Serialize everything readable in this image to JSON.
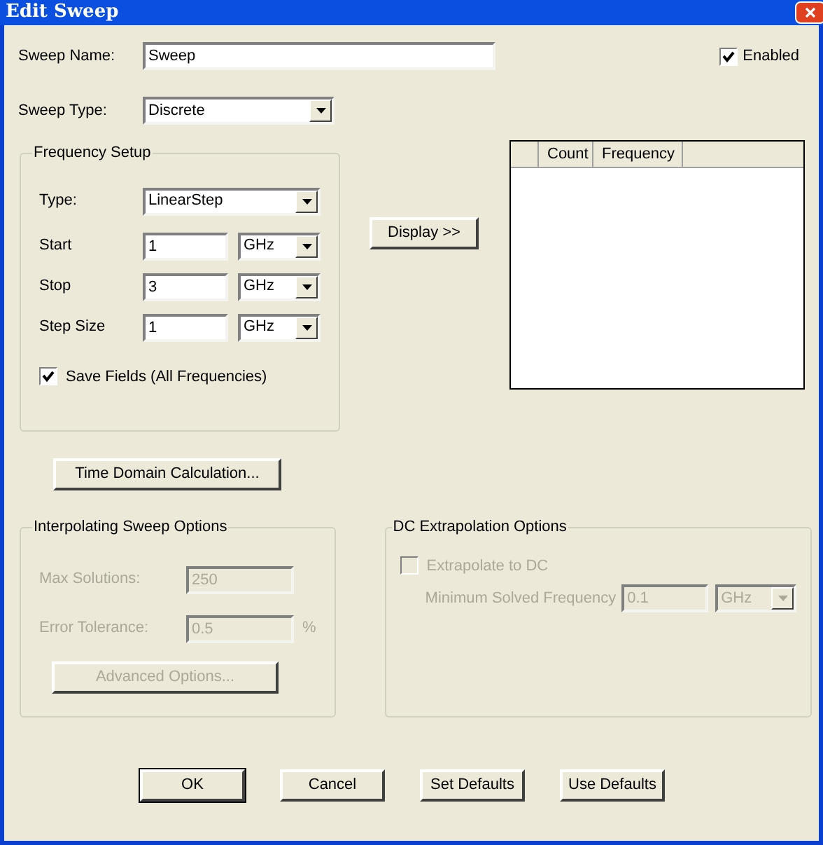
{
  "window": {
    "title": "Edit Sweep"
  },
  "sweep_name": {
    "label": "Sweep Name:",
    "value": "Sweep"
  },
  "enabled": {
    "label": "Enabled",
    "checked": true
  },
  "sweep_type": {
    "label": "Sweep Type:",
    "value": "Discrete"
  },
  "frequency_setup": {
    "title": "Frequency Setup",
    "type": {
      "label": "Type:",
      "value": "LinearStep"
    },
    "rows": [
      {
        "label": "Start",
        "value": "1",
        "unit": "GHz"
      },
      {
        "label": "Stop",
        "value": "3",
        "unit": "GHz"
      },
      {
        "label": "Step Size",
        "value": "1",
        "unit": "GHz"
      }
    ],
    "save_fields": {
      "label": "Save Fields (All Frequencies)",
      "checked": true
    }
  },
  "display_button": "Display >>",
  "table": {
    "columns": [
      "Count",
      "Frequency"
    ]
  },
  "time_domain_button": "Time Domain Calculation...",
  "interpolating": {
    "title": "Interpolating Sweep Options",
    "disabled": true,
    "max_solutions": {
      "label": "Max Solutions:",
      "value": "250"
    },
    "error_tolerance": {
      "label": "Error Tolerance:",
      "value": "0.5",
      "unit": "%"
    },
    "advanced_button": "Advanced Options..."
  },
  "dc_extrapolation": {
    "title": "DC Extrapolation Options",
    "disabled": true,
    "extrapolate": {
      "label": "Extrapolate to DC",
      "checked": false
    },
    "min_freq": {
      "label": "Minimum Solved Frequency",
      "value": "0.1",
      "unit": "GHz"
    }
  },
  "buttons": [
    {
      "label": "OK",
      "default": true
    },
    {
      "label": "Cancel",
      "default": false
    },
    {
      "label": "Set Defaults",
      "default": false
    },
    {
      "label": "Use Defaults",
      "default": false
    }
  ]
}
